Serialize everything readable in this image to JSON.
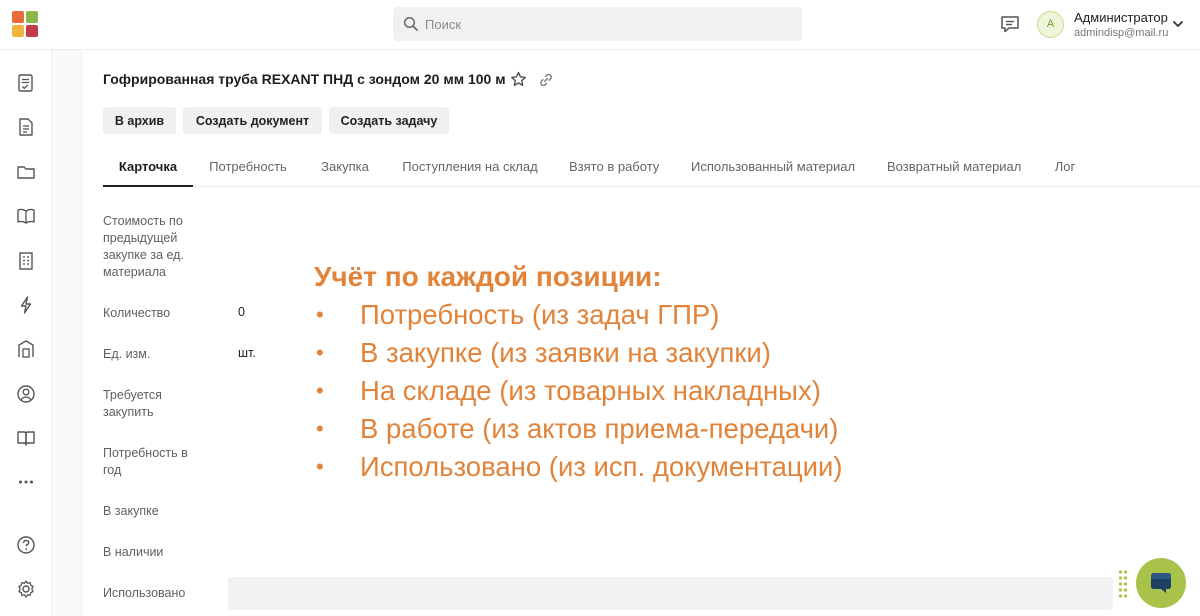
{
  "colors": {
    "accent": "#a9c24a",
    "overlay_text": "#e2833a",
    "logo": [
      "#e86b3a",
      "#8bb84a",
      "#f1b43d",
      "#c43b4a"
    ]
  },
  "header": {
    "search_placeholder": "Поиск",
    "user": {
      "avatar_letter": "A",
      "name": "Администратор",
      "email": "admindisp@mail.ru"
    }
  },
  "sidebar": {
    "items": [
      {
        "icon": "checklist-icon"
      },
      {
        "icon": "document-icon"
      },
      {
        "icon": "folder-icon"
      },
      {
        "icon": "book-open-icon"
      },
      {
        "icon": "building-icon"
      },
      {
        "icon": "lightning-icon"
      },
      {
        "icon": "warehouse-icon"
      },
      {
        "icon": "user-circle-icon"
      },
      {
        "icon": "book-icon"
      },
      {
        "icon": "more-icon"
      },
      {
        "icon": "help-icon"
      },
      {
        "icon": "settings-icon"
      }
    ]
  },
  "page": {
    "title": "Гофрированная труба REXANT ПНД с зондом 20 мм 100 м",
    "actions": {
      "archive": "В архив",
      "create_document": "Создать документ",
      "create_task": "Создать задачу"
    },
    "tabs": [
      {
        "label": "Карточка",
        "active": true
      },
      {
        "label": "Потребность",
        "active": false
      },
      {
        "label": "Закупка",
        "active": false
      },
      {
        "label": "Поступления на склад",
        "active": false
      },
      {
        "label": "Взято в работу",
        "active": false
      },
      {
        "label": "Использованный материал",
        "active": false
      },
      {
        "label": "Возвратный материал",
        "active": false
      },
      {
        "label": "Лог",
        "active": false
      }
    ],
    "fields": [
      {
        "label": "Стоимость по предыдущей закупке за ед. материала",
        "value": ""
      },
      {
        "label": "Количество",
        "value": "0"
      },
      {
        "label": "Ед. изм.",
        "value": "шт."
      },
      {
        "label": "Требуется закупить",
        "value": ""
      },
      {
        "label": "Потребность в год",
        "value": ""
      },
      {
        "label": "В закупке",
        "value": ""
      },
      {
        "label": "В наличии",
        "value": ""
      },
      {
        "label": "Использовано",
        "value": ""
      }
    ]
  },
  "overlay": {
    "title": "Учёт по каждой позиции:",
    "bullet": "•",
    "items": [
      "Потребность (из задач ГПР)",
      "В закупке (из заявки на закупки)",
      "На складе (из товарных накладных)",
      "В работе (из актов приема-передачи)",
      "Использовано (из исп. документации)"
    ]
  }
}
